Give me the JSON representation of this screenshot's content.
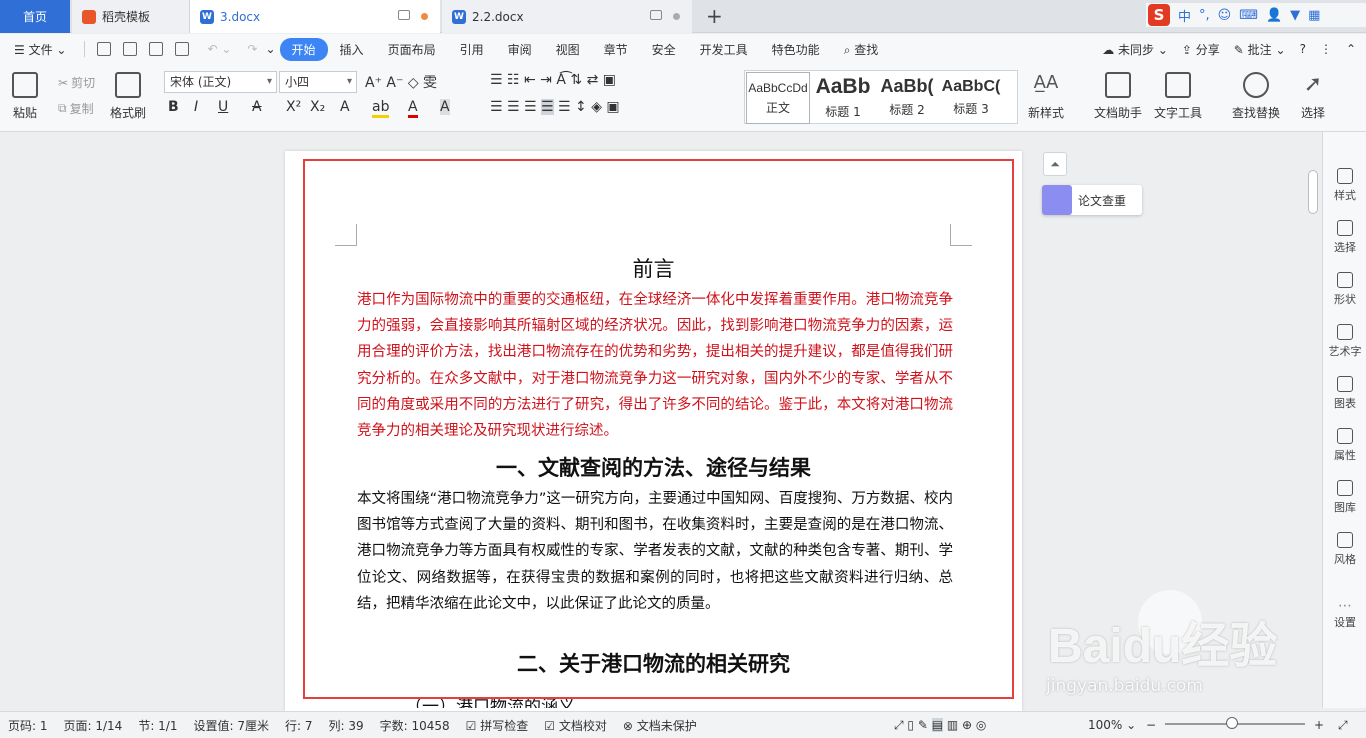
{
  "tabs": [
    {
      "label": "首页"
    },
    {
      "label": "稻壳模板"
    },
    {
      "label": "3.docx"
    },
    {
      "label": "2.2.docx"
    }
  ],
  "ime": {
    "labels": [
      "中",
      "°,"
    ]
  },
  "menu": {
    "file": "文件",
    "items": [
      "开始",
      "插入",
      "页面布局",
      "引用",
      "审阅",
      "视图",
      "章节",
      "安全",
      "开发工具",
      "特色功能",
      "查找"
    ],
    "active": "开始",
    "right": {
      "sync": "未同步",
      "share": "分享",
      "comment": "批注"
    }
  },
  "ribbon": {
    "paste": "粘贴",
    "cut": "剪切",
    "copy": "复制",
    "format_painter": "格式刷",
    "font": "宋体 (正文)",
    "size": "小四",
    "styles": [
      {
        "preview": "AaBbCcDd",
        "label": "正文"
      },
      {
        "preview": "AaBb",
        "label": "标题 1"
      },
      {
        "preview": "AaBb(",
        "label": "标题 2"
      },
      {
        "preview": "AaBbC(",
        "label": "标题 3"
      }
    ],
    "new_style": "新样式",
    "doc_helper": "文档助手",
    "text_tool": "文字工具",
    "find_replace": "查找替换",
    "select": "选择"
  },
  "document": {
    "title": "前言",
    "intro": "港口作为国际物流中的重要的交通枢纽，在全球经济一体化中发挥着重要作用。港口物流竞争力的强弱，会直接影响其所辐射区域的经济状况。因此，找到影响港口物流竞争力的因素，运用合理的评价方法，找出港口物流存在的优势和劣势，提出相关的提升建议，都是值得我们研究分析的。在众多文献中，对于港口物流竞争力这一研究对象，国内外不少的专家、学者从不同的角度或采用不同的方法进行了研究，得出了许多不同的结论。鉴于此，本文将对港口物流竞争力的相关理论及研究现状进行综述。",
    "h1": "一、文献查阅的方法、途径与结果",
    "body": "本文将围绕“港口物流竞争力”这一研究方向，主要通过中国知网、百度搜狗、万方数据、校内图书馆等方式查阅了大量的资料、期刊和图书，在收集资料时，主要是查阅的是在港口物流、港口物流竞争力等方面具有权威性的专家、学者发表的文献，文献的种类包含专著、期刊、学位论文、网络数据等，在获得宝贵的数据和案例的同时，也将把这些文献资料进行归纳、总结，把精华浓缩在此论文中，以此保证了此论文的质量。",
    "h2": "二、关于港口物流的相关研究",
    "sub": "（一）港口物流的涵义"
  },
  "float": {
    "thesis_check": "论文查重"
  },
  "side": [
    "样式",
    "选择",
    "形状",
    "艺术字",
    "图表",
    "属性",
    "图库",
    "风格",
    "设置"
  ],
  "status": {
    "page_no": "页码: 1",
    "page": "页面: 1/14",
    "section": "节: 1/1",
    "setting": "设置值: 7厘米",
    "row": "行: 7",
    "col": "列: 39",
    "words": "字数: 10458",
    "spell": "拼写检查",
    "proof": "文档校对",
    "protect": "文档未保护",
    "zoom": "100%"
  },
  "watermark": {
    "brand": "Baidu经验",
    "url": "jingyan.baidu.com"
  }
}
